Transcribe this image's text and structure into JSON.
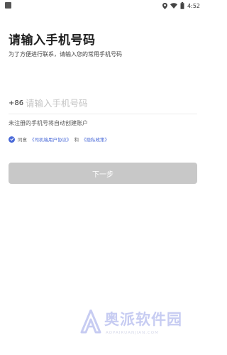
{
  "status_bar": {
    "time": "4:52",
    "icons": [
      "location-icon",
      "wifi-icon",
      "battery-icon"
    ]
  },
  "page": {
    "title": "请输入手机号码",
    "subtitle": "为了方便进行联系，请输入您的常用手机号码"
  },
  "phone": {
    "country_code": "+86",
    "placeholder": "请输入手机号码",
    "value": ""
  },
  "notice": "未注册的手机号将自动创建账户",
  "agreement": {
    "checked": true,
    "prefix": "同意",
    "link1": "《司机端用户协议》",
    "connector": "和",
    "link2": "《隐私政策》"
  },
  "next_button": {
    "label": "下一步",
    "color": "#c8c8c8"
  },
  "watermark": {
    "text": "奥派软件园",
    "url": "AOPAIRUANJIAN.COM"
  },
  "colors": {
    "accent": "#4a6ad8",
    "title": "#1f1f1f",
    "placeholder": "#c4c4c4"
  }
}
